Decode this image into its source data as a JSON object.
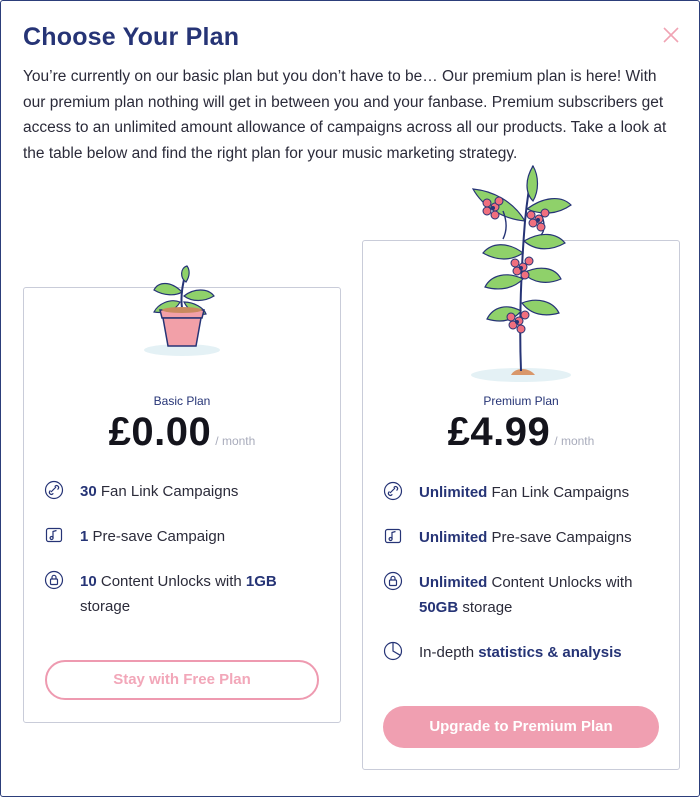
{
  "modal": {
    "title": "Choose Your Plan",
    "intro": "You’re currently on our basic plan but you don’t have to be… Our premium plan is here! With our premium plan nothing will get in between you and your fanbase. Premium subscribers get access to an unlimited amount allowance of campaigns across all our products. Take a look at the table below and find the right plan for your music marketing strategy.",
    "close_icon": "close-icon"
  },
  "colors": {
    "navy": "#263476",
    "pink": "#f09fb1",
    "border": "#c9ccd9"
  },
  "basic": {
    "name": "Basic Plan",
    "price": "£0.00",
    "per": "/ month",
    "features": [
      {
        "icon": "link-icon",
        "bold": "30",
        "text": " Fan Link Campaigns"
      },
      {
        "icon": "music-note-icon",
        "bold": "1",
        "text": " Pre-save Campaign"
      },
      {
        "icon": "lock-icon",
        "bold": "10",
        "text": " Content Unlocks with ",
        "bold2": "1GB",
        "text2": "storage"
      }
    ],
    "button": "Stay with Free Plan"
  },
  "premium": {
    "name": "Premium Plan",
    "price": "£4.99",
    "per": "/ month",
    "features": [
      {
        "icon": "link-icon",
        "bold": "Unlimited",
        "text": " Fan Link Campaigns"
      },
      {
        "icon": "music-note-icon",
        "bold": "Unlimited",
        "text": " Pre-save Campaigns"
      },
      {
        "icon": "lock-icon",
        "bold": "Unlimited",
        "text": " Content Unlocks with",
        "bold2": "50GB",
        "text2": " storage"
      },
      {
        "icon": "pie-chart-icon",
        "text": "In-depth ",
        "bold": "statistics & analysis"
      }
    ],
    "button": "Upgrade to Premium Plan"
  }
}
